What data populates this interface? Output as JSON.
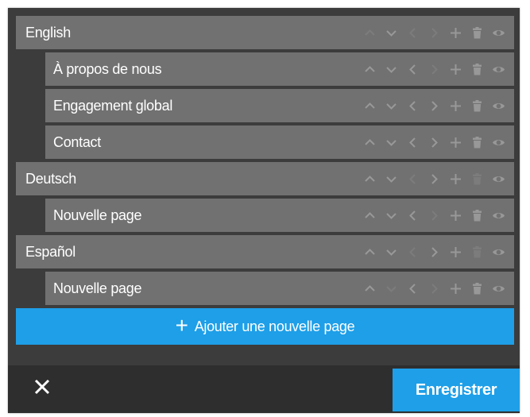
{
  "tree": [
    {
      "label": "English",
      "level": 0,
      "dim": {
        "up": true,
        "down": false,
        "left": true,
        "right": true,
        "add": false,
        "trash": false,
        "eye": false
      }
    },
    {
      "label": "À propos de nous",
      "level": 1,
      "dim": {
        "up": false,
        "down": false,
        "left": false,
        "right": true,
        "add": false,
        "trash": false,
        "eye": false
      }
    },
    {
      "label": "Engagement global",
      "level": 1,
      "dim": {
        "up": false,
        "down": false,
        "left": false,
        "right": false,
        "add": false,
        "trash": false,
        "eye": false
      }
    },
    {
      "label": "Contact",
      "level": 1,
      "dim": {
        "up": false,
        "down": false,
        "left": false,
        "right": false,
        "add": false,
        "trash": false,
        "eye": false
      }
    },
    {
      "label": "Deutsch",
      "level": 0,
      "dim": {
        "up": false,
        "down": false,
        "left": true,
        "right": false,
        "add": false,
        "trash": true,
        "eye": false
      }
    },
    {
      "label": "Nouvelle page",
      "level": 1,
      "dim": {
        "up": false,
        "down": false,
        "left": false,
        "right": true,
        "add": false,
        "trash": false,
        "eye": false
      }
    },
    {
      "label": "Español",
      "level": 0,
      "dim": {
        "up": false,
        "down": false,
        "left": true,
        "right": false,
        "add": false,
        "trash": true,
        "eye": false
      }
    },
    {
      "label": "Nouvelle page",
      "level": 1,
      "dim": {
        "up": false,
        "down": true,
        "left": false,
        "right": true,
        "add": false,
        "trash": false,
        "eye": false
      }
    }
  ],
  "add_page": {
    "plus": "+",
    "label": "Ajouter une nouvelle page"
  },
  "footer": {
    "save_label": "Enregistrer"
  },
  "icons": [
    "chevron-up-icon",
    "chevron-down-icon",
    "chevron-left-icon",
    "chevron-right-icon",
    "plus-icon",
    "trash-icon",
    "eye-icon",
    "close-icon"
  ],
  "colors": {
    "accent": "#1e9fe8",
    "row_bg": "#717171",
    "panel_bg": "#3c3c3c",
    "footer_bg": "#2e2e2e"
  }
}
